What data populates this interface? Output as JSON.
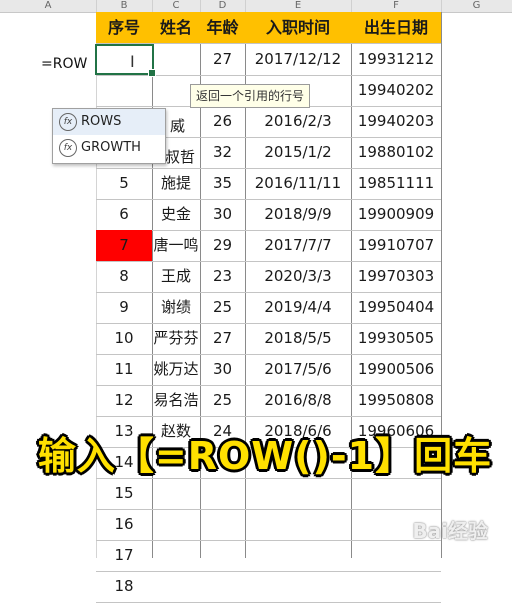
{
  "column_headers": [
    "A",
    "B",
    "C",
    "D",
    "E",
    "F",
    "G"
  ],
  "formula_text": "=ROW",
  "tooltip": "返回一个引用的行号",
  "autocomplete": [
    {
      "label": "ROWS",
      "icon": "function-icon"
    },
    {
      "label": "GROWTH",
      "icon": "function-icon"
    }
  ],
  "table": {
    "headers": [
      "序号",
      "姓名",
      "年龄",
      "入职时间",
      "出生日期"
    ],
    "rows": [
      [
        "",
        "",
        "27",
        "2017/12/12",
        "19931212"
      ],
      [
        "",
        "",
        "",
        "",
        "19940202"
      ],
      [
        "",
        "",
        "26",
        "2016/2/3",
        "19940203"
      ],
      [
        "",
        "",
        "32",
        "2015/1/2",
        "19880102"
      ],
      [
        "5",
        "施提",
        "35",
        "2016/11/11",
        "19851111"
      ],
      [
        "6",
        "史金",
        "30",
        "2018/9/9",
        "19900909"
      ],
      [
        "7",
        "唐一鸣",
        "29",
        "2017/7/7",
        "19910707"
      ],
      [
        "8",
        "王成",
        "23",
        "2020/3/3",
        "19970303"
      ],
      [
        "9",
        "谢绩",
        "25",
        "2019/4/4",
        "19950404"
      ],
      [
        "10",
        "严芬芬",
        "27",
        "2018/5/5",
        "19930505"
      ],
      [
        "11",
        "姚万达",
        "30",
        "2017/5/6",
        "19900506"
      ],
      [
        "12",
        "易名浩",
        "25",
        "2016/8/8",
        "19950808"
      ],
      [
        "13",
        "赵数",
        "24",
        "2018/6/6",
        "19960606"
      ],
      [
        "14",
        "",
        "",
        "",
        ""
      ],
      [
        "15",
        "",
        "",
        "",
        ""
      ],
      [
        "16",
        "",
        "",
        "",
        ""
      ],
      [
        "17",
        "",
        "",
        "",
        ""
      ],
      [
        "18",
        "",
        "",
        "",
        ""
      ]
    ]
  },
  "partial_cells": {
    "r1_age_partial": "/2",
    "r2_name": "威",
    "r3_name": "叔哲"
  },
  "caption": "输入【=ROW()-1】回车",
  "watermark": "Bai经验",
  "colors": {
    "header_fill": "#ffc000",
    "highlight_cell": "#ff0000",
    "caption_fill": "#ffe000",
    "active_border": "#217346"
  }
}
